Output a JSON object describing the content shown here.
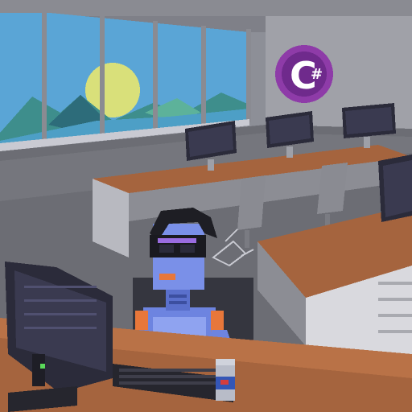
{
  "scene": {
    "description_free": true,
    "logo": {
      "letter": "C",
      "symbol": "#",
      "color": "#8e3ba8",
      "ring": "#ffffff"
    },
    "palette": {
      "sky": "#5fa8d8",
      "wall": "#9a9ba3",
      "floor": "#6f7078",
      "desk_top": "#a5643e",
      "desk_side": "#cfcfcf",
      "robot_body": "#6d84e0",
      "robot_accent": "#e8773a",
      "monitor": "#2b2b3a"
    },
    "robot": {
      "badge_icon": "flag-icon",
      "visor_icon": "vr-visor-icon"
    },
    "drink": {
      "can_icon": "energy-drink-can-icon"
    }
  }
}
